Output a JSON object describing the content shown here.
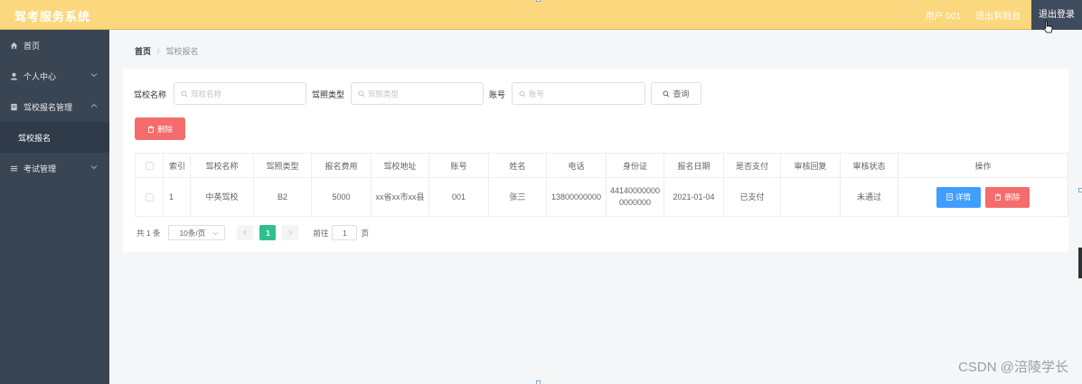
{
  "app": {
    "title": "驾考服务系统",
    "user_label": "用户 001",
    "back_to_front_label": "退出到前台",
    "logout_label": "退出登录"
  },
  "sidebar": {
    "items": [
      {
        "label": "首页",
        "icon": "home-icon",
        "has_arrow": false
      },
      {
        "label": "个人中心",
        "icon": "user-icon",
        "has_arrow": true
      },
      {
        "label": "驾校报名管理",
        "icon": "document-icon",
        "has_arrow": true,
        "expanded": true
      },
      {
        "label": "驾校报名",
        "sub": true,
        "active": true
      },
      {
        "label": "考试管理",
        "icon": "menu-icon",
        "has_arrow": true
      }
    ]
  },
  "breadcrumb": {
    "home": "首页",
    "separator": "/",
    "current": "驾校报名"
  },
  "search": {
    "school_label": "驾校名称",
    "school_placeholder": "驾校名称",
    "type_label": "驾照类型",
    "type_placeholder": "驾照类型",
    "account_label": "账号",
    "account_placeholder": "账号",
    "query_label": "查询"
  },
  "toolbar": {
    "delete_label": "删除"
  },
  "table": {
    "headers": [
      "",
      "索引",
      "驾校名称",
      "驾照类型",
      "报名费用",
      "驾校地址",
      "账号",
      "姓名",
      "电话",
      "身份证",
      "报名日期",
      "是否支付",
      "审核回复",
      "审核状态",
      "操作"
    ],
    "rows": [
      {
        "index": "1",
        "school": "中英驾校",
        "license_type": "B2",
        "fee": "5000",
        "address": "xx省xx市xx县",
        "account": "001",
        "name": "张三",
        "phone": "13800000000",
        "id_card": "441400000000000000",
        "date": "2021-01-04",
        "paid": "已支付",
        "reply": "",
        "status": "未通过",
        "detail_label": "详情",
        "delete_label": "删除"
      }
    ]
  },
  "pagination": {
    "total": "共 1 条",
    "page_size": "10条/页",
    "current_page": "1",
    "goto_label": "前往",
    "goto_value": "1",
    "page_suffix": "页"
  },
  "watermark": "CSDN @涪陵学长",
  "colors": {
    "topbar": "#fbd77e",
    "sidebar": "#3a4554",
    "danger": "#f56c6c",
    "primary": "#409eff",
    "pager_active": "#2fbf8f"
  }
}
